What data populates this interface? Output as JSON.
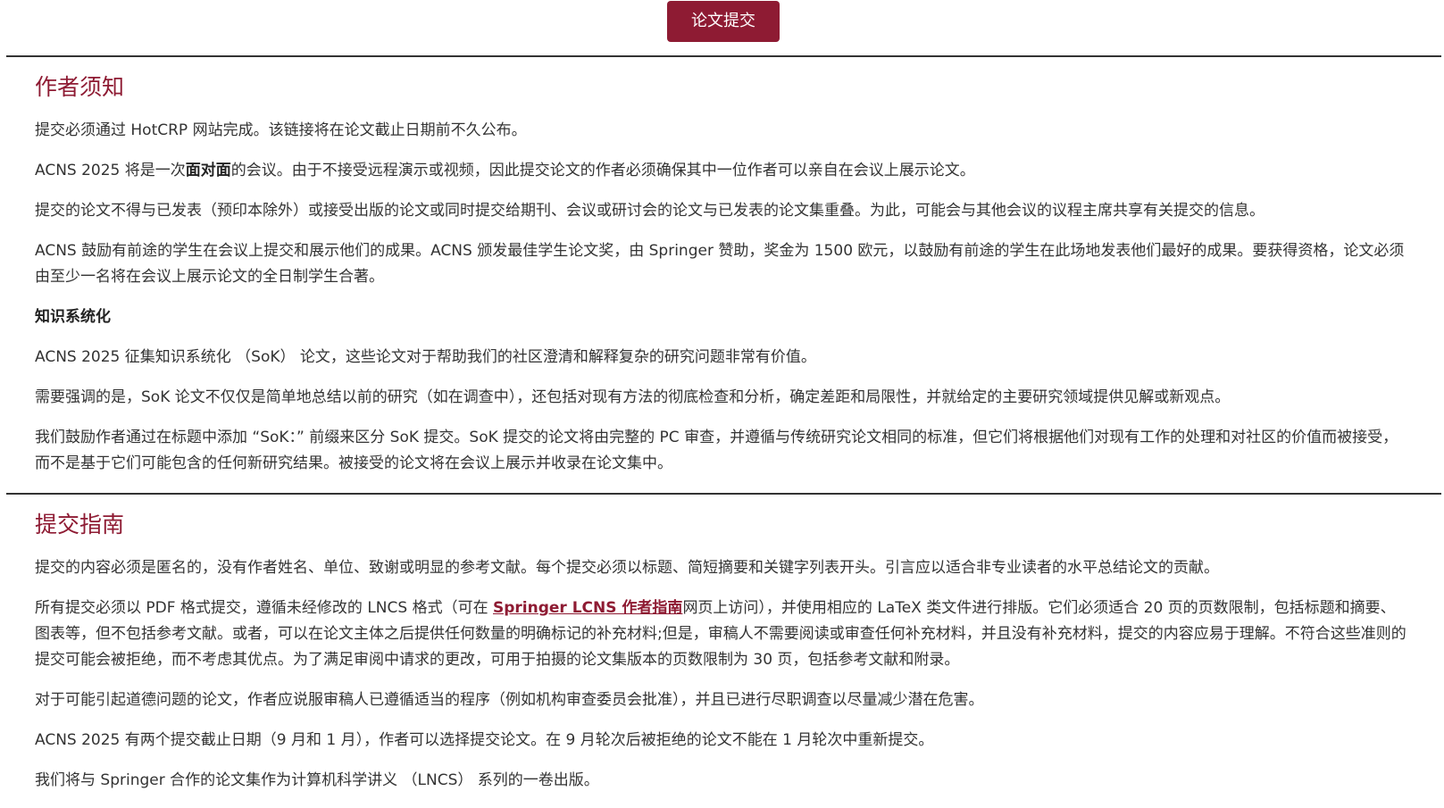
{
  "header": {
    "submit_button": "论文提交"
  },
  "author_notice": {
    "title": "作者须知",
    "p1": "提交必须通过 HotCRP 网站完成。该链接将在论文截止日期前不久公布。",
    "p2_pre": "ACNS 2025 将是一次",
    "p2_bold": "面对面",
    "p2_post": "的会议。由于不接受远程演示或视频，因此提交论文的作者必须确保其中一位作者可以亲自在会议上展示论文。",
    "p3": "提交的论文不得与已发表（预印本除外）或接受出版的论文或同时提交给期刊、会议或研讨会的论文与已发表的论文集重叠。为此，可能会与其他会议的议程主席共享有关提交的信息。",
    "p4": "ACNS 鼓励有前途的学生在会议上提交和展示他们的成果。ACNS 颁发最佳学生论文奖，由 Springer 赞助，奖金为 1500 欧元，以鼓励有前途的学生在此场地发表他们最好的成果。要获得资格，论文必须由至少一名将在会议上展示论文的全日制学生合著。",
    "sok_heading": "知识系统化",
    "p5": "ACNS 2025 征集知识系统化 （SoK） 论文，这些论文对于帮助我们的社区澄清和解释复杂的研究问题非常有价值。",
    "p6": "需要强调的是，SoK 论文不仅仅是简单地总结以前的研究（如在调查中），还包括对现有方法的彻底检查和分析，确定差距和局限性，并就给定的主要研究领域提供见解或新观点。",
    "p7": "我们鼓励作者通过在标题中添加 “SoK：” 前缀来区分 SoK 提交。SoK 提交的论文将由完整的 PC 审查，并遵循与传统研究论文相同的标准，但它们将根据他们对现有工作的处理和对社区的价值而被接受，而不是基于它们可能包含的任何新研究结果。被接受的论文将在会议上展示并收录在论文集中。"
  },
  "guidelines": {
    "title": "提交指南",
    "p1": "提交的内容必须是匿名的，没有作者姓名、单位、致谢或明显的参考文献。每个提交必须以标题、简短摘要和关键字列表开头。引言应以适合非专业读者的水平总结论文的贡献。",
    "p2_pre": "所有提交必须以 PDF 格式提交，遵循未经修改的 LNCS 格式（可在 ",
    "p2_link": "Springer LCNS 作者指南",
    "p2_post": "网页上访问），并使用相应的 LaTeX 类文件进行排版。它们必须适合 20 页的页数限制，包括标题和摘要、图表等，但不包括参考文献。或者，可以在论文主体之后提供任何数量的明确标记的补充材料;但是，审稿人不需要阅读或审查任何补充材料，并且没有补充材料，提交的内容应易于理解。不符合这些准则的提交可能会被拒绝，而不考虑其优点。为了满足审阅中请求的更改，可用于拍摄的论文集版本的页数限制为 30 页，包括参考文献和附录。",
    "p3": "对于可能引起道德问题的论文，作者应说服审稿人已遵循适当的程序（例如机构审查委员会批准），并且已进行尽职调查以尽量减少潜在危害。",
    "p4": "ACNS 2025 有两个提交截止日期（9 月和 1 月），作者可以选择提交论文。在 9 月轮次后被拒绝的论文不能在 1 月轮次中重新提交。",
    "p5": "我们将与 Springer 合作的论文集作为计算机科学讲义 （LNCS） 系列的一卷出版。"
  }
}
